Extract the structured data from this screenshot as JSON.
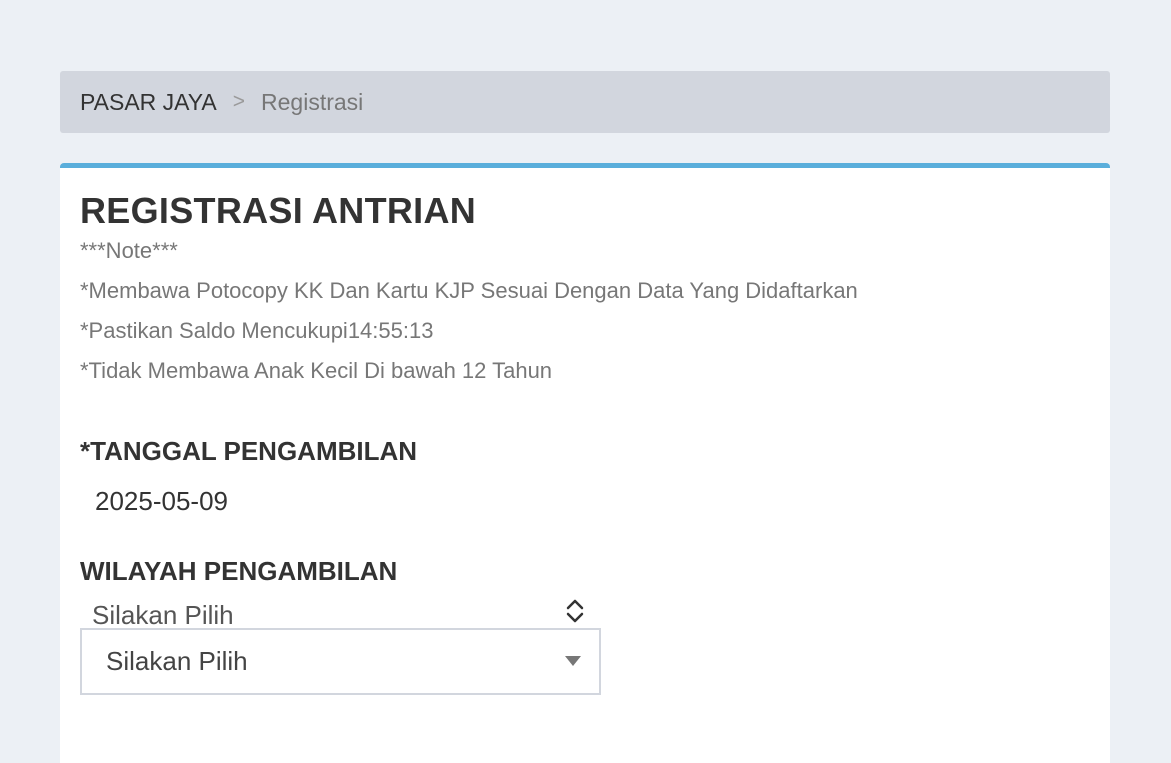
{
  "breadcrumb": {
    "home": "PASAR JAYA",
    "separator": ">",
    "current": "Registrasi"
  },
  "card": {
    "title": "REGISTRASI ANTRIAN",
    "notes": [
      "***Note***",
      "*Membawa Potocopy KK Dan Kartu KJP Sesuai Dengan Data Yang Didaftarkan",
      "*Pastikan Saldo Mencukupi14:55:13",
      "*Tidak Membawa Anak Kecil Di bawah 12 Tahun"
    ]
  },
  "form": {
    "tanggal": {
      "label": "*TANGGAL PENGAMBILAN",
      "value": "2025-05-09"
    },
    "wilayah": {
      "label": "WILAYAH PENGAMBILAN",
      "native_selected": "Silakan Pilih",
      "styled_selected": "Silakan Pilih"
    }
  },
  "colors": {
    "page_bg": "#ecf0f5",
    "breadcrumb_bg": "#d2d6de",
    "card_accent": "#5aaedb"
  }
}
